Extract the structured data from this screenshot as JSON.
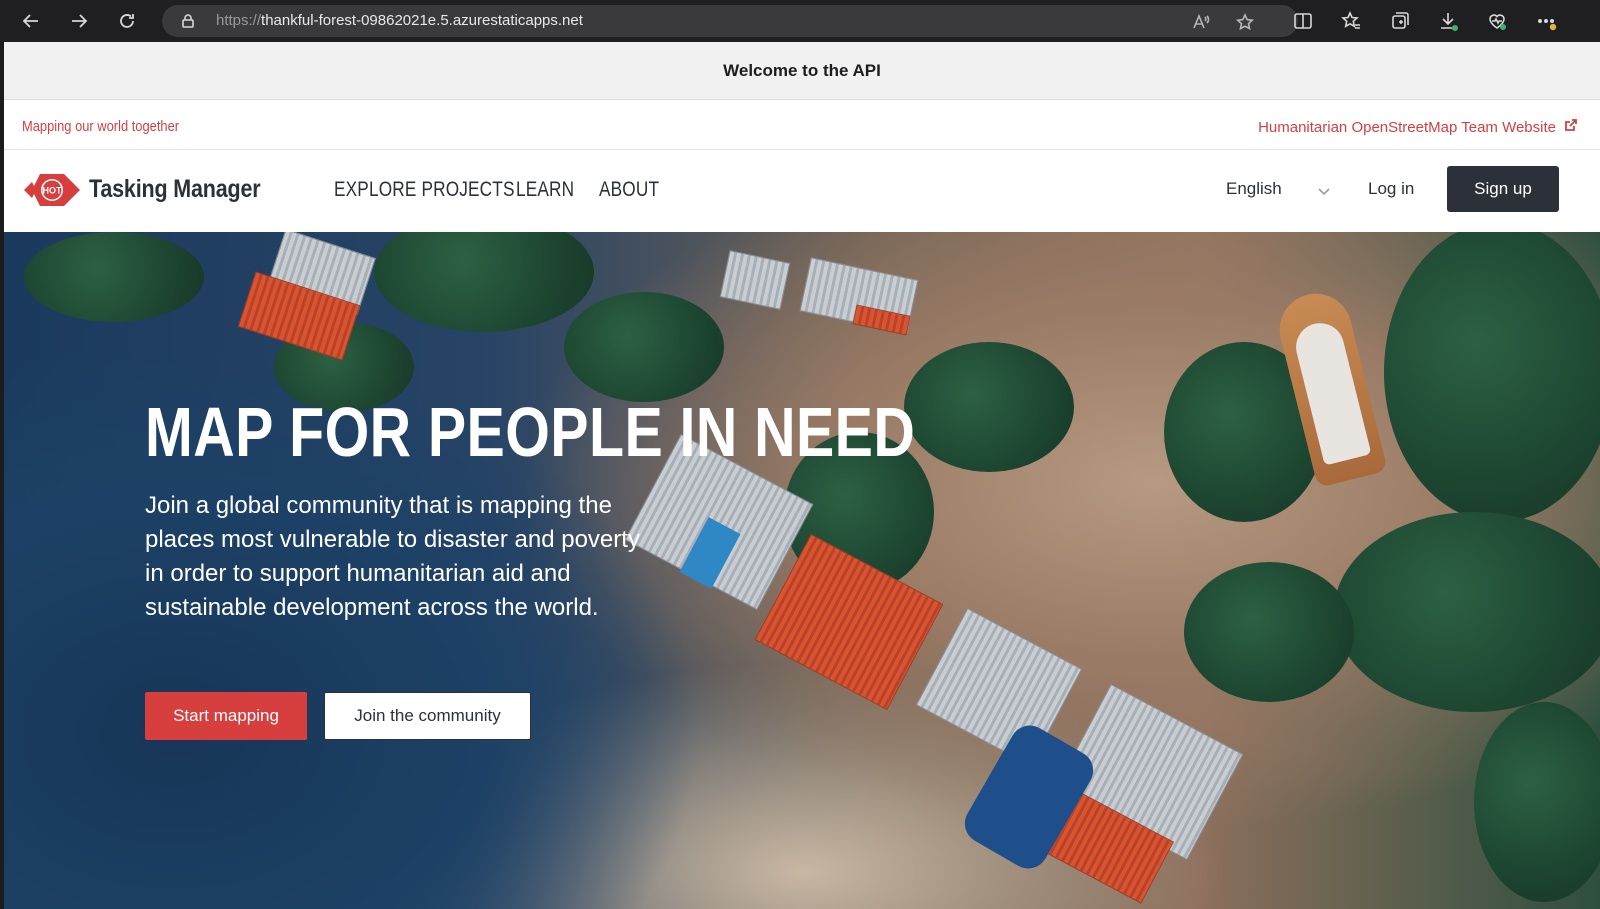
{
  "browser": {
    "url_protocol": "https://",
    "url_host": "thankful-forest-09862021e.5.azurestaticapps.net"
  },
  "banner": {
    "text": "Welcome to the API"
  },
  "topline": {
    "tagline": "Mapping our world together",
    "hot_website_link": "Humanitarian OpenStreetMap Team Website"
  },
  "nav": {
    "logo_text": "HOT",
    "brand": "Tasking Manager",
    "items": [
      {
        "label": "EXPLORE PROJECTS"
      },
      {
        "label": "LEARN"
      },
      {
        "label": "ABOUT"
      }
    ],
    "language": "English",
    "login": "Log in",
    "signup": "Sign up"
  },
  "hero": {
    "title": "MAP FOR PEOPLE IN NEED",
    "text": "Join a global community that is mapping the places most vulnerable to disaster and poverty in order to support humanitarian aid and sustainable development across the world.",
    "start_button": "Start mapping",
    "join_button": "Join the community"
  },
  "colors": {
    "accent": "#d73f3f",
    "dark": "#2c3038"
  }
}
